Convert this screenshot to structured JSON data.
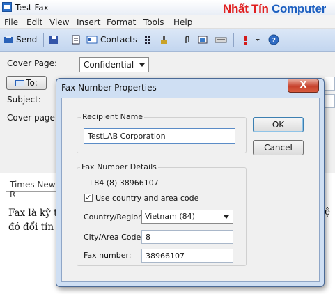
{
  "window": {
    "title": "Test Fax"
  },
  "brand": {
    "part1": "Nhất Tín",
    "part2": "Computer"
  },
  "menu": [
    "File",
    "Edit",
    "View",
    "Insert",
    "Format",
    "Tools",
    "Help"
  ],
  "toolbar": {
    "send_label": "Send",
    "contacts_label": "Contacts",
    "icons": [
      "save-icon",
      "page-icon",
      "contacts-icon",
      "grid-icon",
      "clean-icon",
      "attach-icon",
      "image-icon",
      "scanner-icon",
      "priority-icon",
      "help-icon"
    ]
  },
  "form": {
    "cover_page_label": "Cover Page:",
    "cover_page_value": "Confidential",
    "to_button": "To:",
    "subject_label": "Subject:",
    "cover_notes_label": "Cover page n"
  },
  "editor": {
    "font_name": "Times New R",
    "body_line1": "Fax là kỹ th",
    "body_line1_right": "ệ",
    "body_line2": "đó đổi tín h"
  },
  "dialog": {
    "title": "Fax Number Properties",
    "close_label": "X",
    "recipient_group": "Recipient Name",
    "recipient_value": "TestLAB Corporation",
    "ok_label": "OK",
    "cancel_label": "Cancel",
    "details_group": "Fax Number Details",
    "full_number": "+84 (8) 38966107",
    "use_country_label": "Use country and area code",
    "use_country_checked": true,
    "country_label": "Country/Region:",
    "country_value": "Vietnam (84)",
    "city_label": "City/Area Code:",
    "city_value": "8",
    "fax_label": "Fax number:",
    "fax_value": "38966107"
  },
  "colors": {
    "brand_red": "#e02020",
    "brand_blue": "#1c5fc0",
    "dialog_frame": "#cfdff3"
  }
}
